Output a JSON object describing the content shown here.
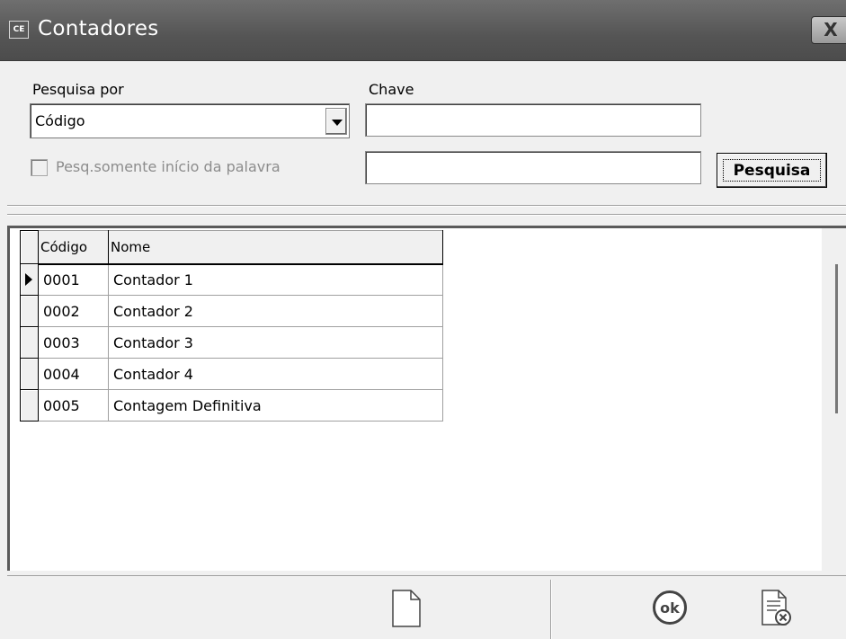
{
  "window": {
    "title": "Contadores",
    "app_icon_text": "CE",
    "close_label": "X"
  },
  "search": {
    "search_by_label": "Pesquisa por",
    "search_by_value": "Código",
    "key_label": "Chave",
    "key_value": "",
    "key2_value": "",
    "prefix_checkbox_label": "Pesq.somente início da palavra",
    "prefix_checkbox_checked": false,
    "search_button_label": "Pesquisa"
  },
  "grid": {
    "columns": [
      "Código",
      "Nome"
    ],
    "rows": [
      {
        "codigo": "0001",
        "nome": "Contador 1",
        "current": true
      },
      {
        "codigo": "0002",
        "nome": "Contador 2",
        "current": false
      },
      {
        "codigo": "0003",
        "nome": "Contador 3",
        "current": false
      },
      {
        "codigo": "0004",
        "nome": "Contador 4",
        "current": false
      },
      {
        "codigo": "0005",
        "nome": "Contagem Definitiva",
        "current": false
      }
    ]
  },
  "footer": {
    "new_icon": "new-document-icon",
    "ok_label": "ok",
    "cancel_icon": "document-cancel-icon"
  }
}
